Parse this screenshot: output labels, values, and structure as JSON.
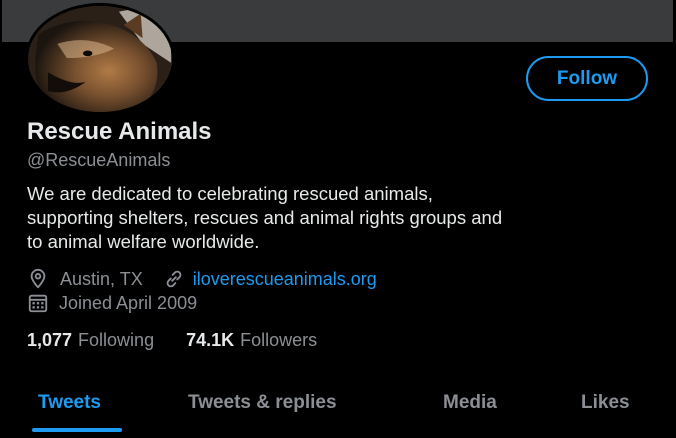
{
  "profile": {
    "name": "Rescue Animals",
    "handle": "@RescueAnimals",
    "bio": "We are dedicated to celebrating rescued animals,\nsupporting shelters, rescues and animal rights groups and\nto animal welfare worldwide.",
    "location": "Austin, TX",
    "website": "iloverescueanimals.org",
    "joined": "Joined April 2009",
    "following_count": "1,077",
    "following_label": "Following",
    "followers_count": "74.1K",
    "followers_label": "Followers"
  },
  "actions": {
    "follow_label": "Follow"
  },
  "tabs": [
    {
      "label": "Tweets",
      "active": true
    },
    {
      "label": "Tweets & replies",
      "active": false
    },
    {
      "label": "Media",
      "active": false
    },
    {
      "label": "Likes",
      "active": false
    }
  ],
  "icons": {
    "location": "location-pin-icon",
    "website": "link-icon",
    "joined": "calendar-icon"
  },
  "colors": {
    "accent": "#1d9bf0",
    "background": "#000000",
    "secondary_text": "#8b8f94",
    "banner": "#3a3b3d"
  }
}
